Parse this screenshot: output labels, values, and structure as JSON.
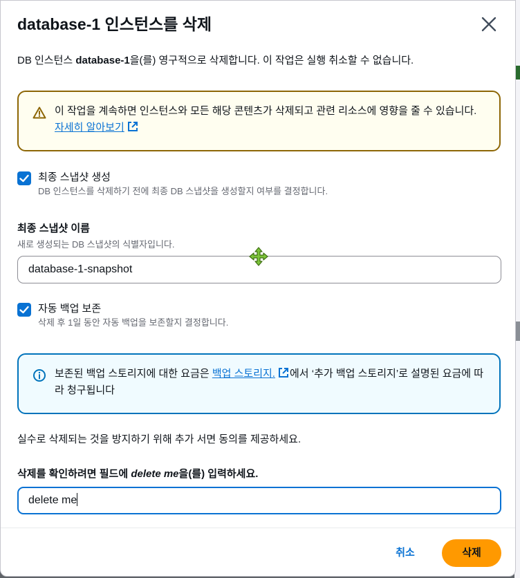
{
  "dialog": {
    "title": "database-1 인스턴스를 삭제",
    "intro_prefix": "DB 인스턴스 ",
    "intro_instance": "database-1",
    "intro_suffix": "을(를) 영구적으로 삭제합니다. 이 작업은 실행 취소할 수 없습니다."
  },
  "warning": {
    "text": "이 작업을 계속하면 인스턴스와 모든 해당 콘텐츠가 삭제되고 관련 리소스에 영향을 줄 수 있습니다. ",
    "link": "자세히 알아보기"
  },
  "final_snapshot": {
    "checked": true,
    "label": "최종 스냅샷 생성",
    "description": "DB 인스턴스를 삭제하기 전에 최종 DB 스냅샷을 생성할지 여부를 결정합니다."
  },
  "snapshot_name": {
    "label": "최종 스냅샷 이름",
    "description": "새로 생성되는 DB 스냅샷의 식별자입니다.",
    "value": "database-1-snapshot"
  },
  "retain_backups": {
    "checked": true,
    "label": "자동 백업 보존",
    "description": "삭제 후 1일 동안 자동 백업을 보존할지 결정합니다."
  },
  "info": {
    "text_before": "보존된 백업 스토리지에 대한 요금은 ",
    "link": "백업 스토리지.",
    "text_after": "에서 ‘추가 백업 스토리지’로 설명된 요금에 따라 청구됩니다"
  },
  "consent_text": "실수로 삭제되는 것을 방지하기 위해 추가 서면 동의를 제공하세요.",
  "confirm": {
    "label_prefix": "삭제를 확인하려면 필드에 ",
    "label_keyword": "delete me",
    "label_suffix": "을(를) 입력하세요.",
    "value": "delete me"
  },
  "buttons": {
    "cancel": "취소",
    "delete": "삭제"
  },
  "colors": {
    "primary": "#ff9900",
    "link": "#0972d3",
    "warning_border": "#8d6605",
    "info_border": "#0073bb"
  }
}
